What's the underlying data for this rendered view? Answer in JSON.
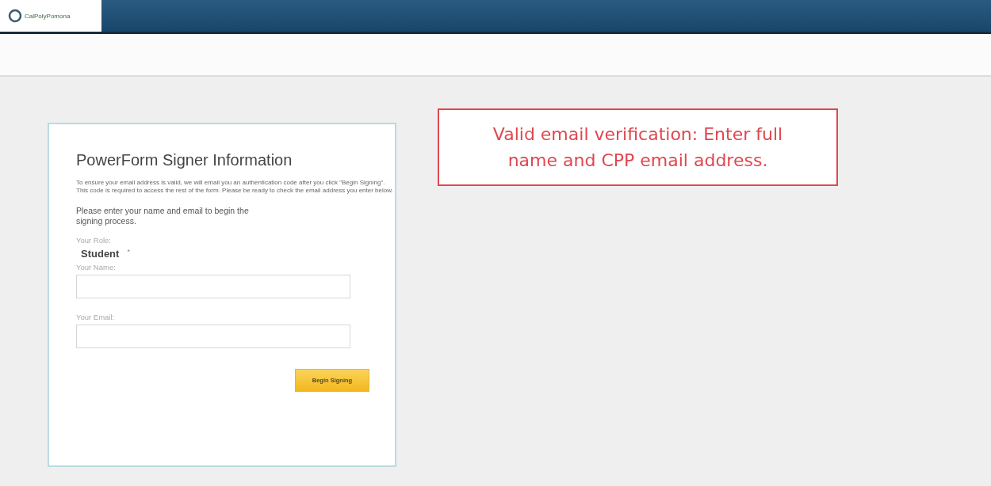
{
  "header": {
    "logo_text": "CalPolyPomona"
  },
  "form": {
    "title": "PowerForm Signer Information",
    "notice": "To ensure your email address is valid, we will email you an authentication code after you click \"Begin Signing\".  This code is required to access the rest of the form.  Please be ready to check the email address you enter below.",
    "instruction": "Please enter your name and email to begin the signing process.",
    "role_label": "Your Role:",
    "role_value": "Student",
    "required_mark": "*",
    "fields": [
      {
        "label": "Your Name:"
      },
      {
        "label": "Your Email:"
      }
    ],
    "submit": "Begin Signing"
  },
  "callout": {
    "text": "Valid email verification: Enter full name and CPP email address."
  }
}
